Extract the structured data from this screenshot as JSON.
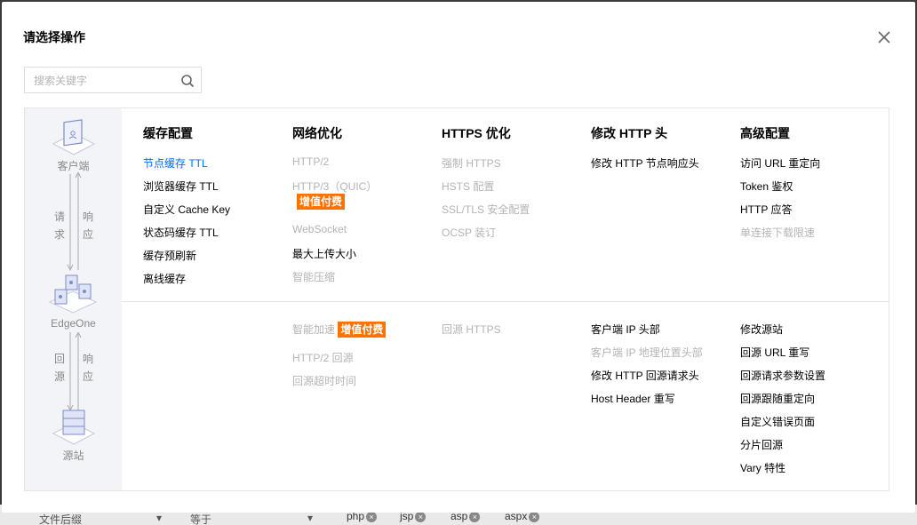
{
  "dialog": {
    "title": "请选择操作",
    "search_placeholder": "搜索关键字"
  },
  "flow": {
    "client": "客户端",
    "request": "请求",
    "response": "响应",
    "edge": "EdgeOne",
    "back_to_origin": "回源",
    "origin_response": "响应",
    "origin": "源站"
  },
  "columns": [
    {
      "title": "缓存配置",
      "top_items": [
        {
          "label": "节点缓存 TTL",
          "state": "active"
        },
        {
          "label": "浏览器缓存 TTL",
          "state": "normal"
        },
        {
          "label": "自定义 Cache Key",
          "state": "normal"
        },
        {
          "label": "状态码缓存 TTL",
          "state": "normal"
        },
        {
          "label": "缓存预刷新",
          "state": "normal"
        },
        {
          "label": "离线缓存",
          "state": "normal"
        }
      ],
      "bottom_items": []
    },
    {
      "title": "网络优化",
      "top_items": [
        {
          "label": "HTTP/2",
          "state": "disabled"
        },
        {
          "label": "HTTP/3（QUIC）",
          "state": "disabled"
        },
        {
          "label": "WebSocket",
          "state": "disabled"
        },
        {
          "label": "最大上传大小",
          "state": "normal"
        },
        {
          "label": "智能压缩",
          "state": "disabled"
        }
      ],
      "bottom_items": [
        {
          "label": "智能加速",
          "state": "disabled"
        },
        {
          "label": "HTTP/2 回源",
          "state": "disabled"
        },
        {
          "label": "回源超时时间",
          "state": "disabled"
        }
      ]
    },
    {
      "title": "HTTPS 优化",
      "top_items": [
        {
          "label": "强制 HTTPS",
          "state": "disabled"
        },
        {
          "label": "HSTS 配置",
          "state": "disabled"
        },
        {
          "label": "SSL/TLS 安全配置",
          "state": "disabled"
        },
        {
          "label": "OCSP 装订",
          "state": "disabled"
        }
      ],
      "bottom_items": [
        {
          "label": "回源 HTTPS",
          "state": "disabled"
        }
      ]
    },
    {
      "title": "修改 HTTP 头",
      "top_items": [
        {
          "label": "修改 HTTP 节点响应头",
          "state": "normal"
        }
      ],
      "bottom_items": [
        {
          "label": "客户端 IP 头部",
          "state": "normal"
        },
        {
          "label": "客户端 IP 地理位置头部",
          "state": "disabled"
        },
        {
          "label": "修改 HTTP 回源请求头",
          "state": "normal"
        },
        {
          "label": "Host Header 重写",
          "state": "normal"
        }
      ]
    },
    {
      "title": "高级配置",
      "top_items": [
        {
          "label": "访问 URL 重定向",
          "state": "normal"
        },
        {
          "label": "Token 鉴权",
          "state": "normal"
        },
        {
          "label": "HTTP 应答",
          "state": "normal"
        },
        {
          "label": "单连接下载限速",
          "state": "disabled"
        }
      ],
      "bottom_items": [
        {
          "label": "修改源站",
          "state": "normal"
        },
        {
          "label": "回源 URL 重写",
          "state": "normal"
        },
        {
          "label": "回源请求参数设置",
          "state": "normal"
        },
        {
          "label": "回源跟随重定向",
          "state": "normal"
        },
        {
          "label": "自定义错误页面",
          "state": "normal"
        },
        {
          "label": "分片回源",
          "state": "normal"
        },
        {
          "label": "Vary 特性",
          "state": "normal"
        }
      ]
    }
  ],
  "badges": {
    "value_added": "增值付费"
  },
  "background": {
    "field": "文件后缀",
    "operator": "等于",
    "tags": [
      "php",
      "jsp",
      "asp",
      "aspx"
    ]
  },
  "colors": {
    "accent": "#006eff",
    "badge": "#ff7200",
    "disabled": "#b4b4b4"
  }
}
